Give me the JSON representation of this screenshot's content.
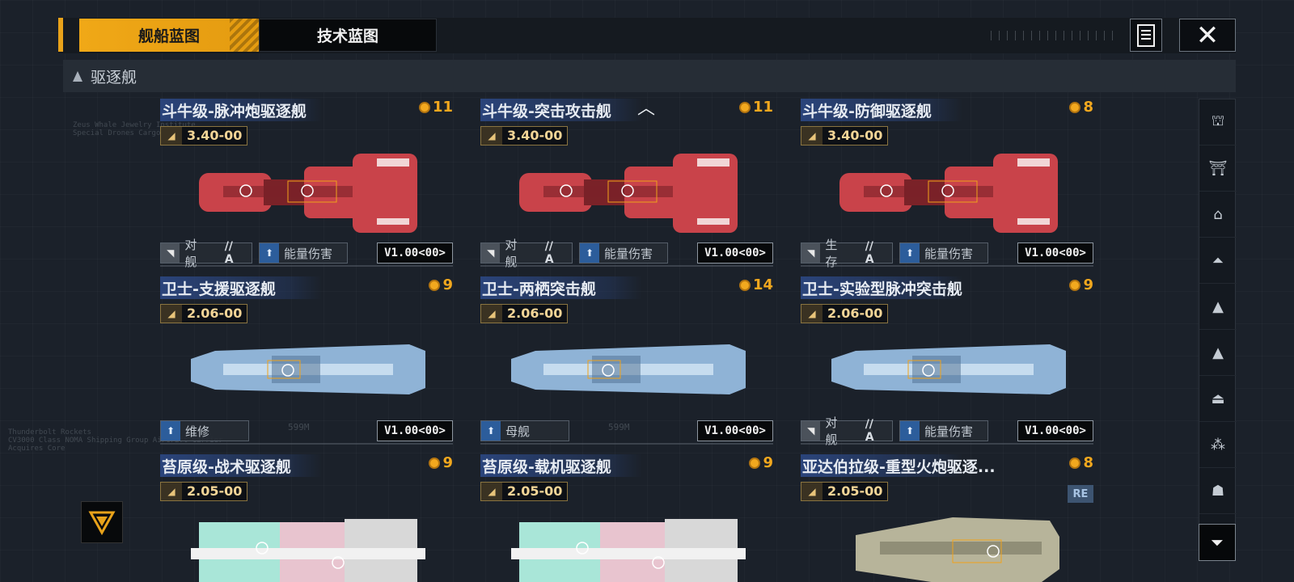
{
  "tabs": [
    {
      "label": "舰船蓝图",
      "active": true
    },
    {
      "label": "技术蓝图",
      "active": false
    }
  ],
  "category": {
    "label": "驱逐舰"
  },
  "accent_color": "#f0a817",
  "cards": [
    {
      "title": "斗牛级-脉冲炮驱逐舰",
      "cost": "11",
      "power": "3.40-00",
      "hull": "red",
      "tags": [
        {
          "icon": "anti-ship-icon",
          "label": "对舰",
          "grade": "// A"
        },
        {
          "icon": "energy-damage-icon",
          "label": "能量伤害"
        }
      ],
      "version": "V1.00<00>"
    },
    {
      "title": "斗牛级-突击攻击舰",
      "cost": "11",
      "power": "3.40-00",
      "hull": "red",
      "tags": [
        {
          "icon": "anti-ship-icon",
          "label": "对舰",
          "grade": "// A"
        },
        {
          "icon": "energy-damage-icon",
          "label": "能量伤害"
        }
      ],
      "version": "V1.00<00>"
    },
    {
      "title": "斗牛级-防御驱逐舰",
      "cost": "8",
      "power": "3.40-00",
      "hull": "red",
      "tags": [
        {
          "icon": "survival-icon",
          "label": "生存",
          "grade": "// A"
        },
        {
          "icon": "energy-damage-icon",
          "label": "能量伤害"
        }
      ],
      "version": "V1.00<00>"
    },
    {
      "title": "卫士-支援驱逐舰",
      "cost": "9",
      "power": "2.06-00",
      "hull": "blue",
      "tags": [
        {
          "icon": "repair-icon",
          "label": "维修"
        }
      ],
      "version": "V1.00<00>"
    },
    {
      "title": "卫士-两栖突击舰",
      "cost": "14",
      "power": "2.06-00",
      "hull": "blue",
      "tags": [
        {
          "icon": "carrier-icon",
          "label": "母舰"
        }
      ],
      "version": "V1.00<00>"
    },
    {
      "title": "卫士-实验型脉冲突击舰",
      "cost": "9",
      "power": "2.06-00",
      "hull": "blue",
      "tags": [
        {
          "icon": "anti-ship-icon",
          "label": "对舰",
          "grade": "// A"
        },
        {
          "icon": "energy-damage-icon",
          "label": "能量伤害"
        }
      ],
      "version": "V1.00<00>"
    },
    {
      "title": "苔原级-战术驱逐舰",
      "cost": "9",
      "power": "2.05-00",
      "hull": "pastel"
    },
    {
      "title": "苔原级-载机驱逐舰",
      "cost": "9",
      "power": "2.05-00",
      "hull": "pastel"
    },
    {
      "title": "亚达伯拉级-重型火炮驱逐...",
      "cost": "8",
      "power": "2.05-00",
      "hull": "olive",
      "badge": "RE"
    }
  ],
  "side_filters": [
    "frigate-class-icon",
    "destroyer-class-icon",
    "cruiser-class-icon",
    "battlecruiser-class-icon",
    "auxiliary-class-icon",
    "carrier-class-icon",
    "battleship-class-icon",
    "squadron-class-icon",
    "special-class-icon"
  ],
  "bg_text": {
    "a": "Zeus Whale Jewelry Institute\nSpecial Drones Cargo",
    "b": "Thunderbolt Rockets\nCV3000 Class NOMA Shipping Group Aircraft Carrier\nAcquires Core",
    "dim1": "599M",
    "dim2": "599M"
  }
}
